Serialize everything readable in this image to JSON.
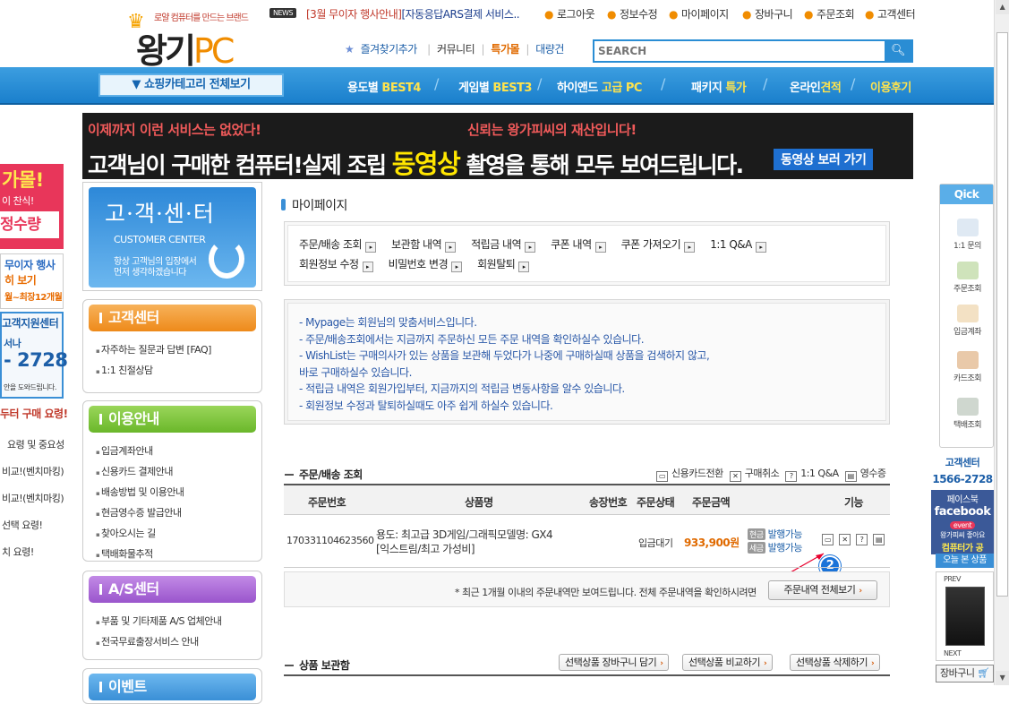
{
  "header": {
    "logo_tagline": "로얄 컴퓨터를 만드는 브랜드",
    "logo_main": "왕기",
    "logo_pc": "PC",
    "news_badge": "NEWS",
    "news_text_red": "[3월 무이자 행사안내]",
    "news_text_blue": "[자동응답ARS결제 서비스..",
    "top_links": [
      "로그아웃",
      "정보수정",
      "마이페이지",
      "장바구니",
      "주문조회",
      "고객센터"
    ],
    "bookmark": "즐겨찾기추가",
    "community": "커뮤니티",
    "special": "특가몰",
    "bulk": "대량건",
    "search_placeholder": "SEARCH"
  },
  "nav": {
    "category_button": "▼  쇼핑카테고리 전체보기",
    "items": [
      {
        "label": "용도별 ",
        "accent": "BEST4"
      },
      {
        "label": "게임별 ",
        "accent": "BEST3"
      },
      {
        "label": "하이앤드 ",
        "accent": "고급 PC"
      },
      {
        "label": "패키지 ",
        "accent": "특가"
      },
      {
        "label": "온라인",
        "accent": "견적"
      },
      {
        "label": "",
        "accent": "이용후기"
      }
    ]
  },
  "banner": {
    "line1_left": "이제까지 이런 서비스는 없었다!",
    "line1_right": "신뢰는 왕가피씨의 재산입니다!",
    "line2_a": "고객님이 구매한 컴퓨터!실제 조립 ",
    "line2_highlight": "동영상",
    "line2_b": " 촬영을 통해 모두 보여드립니다.",
    "cta": "동영상 보러 가기"
  },
  "left_ads": {
    "a1": "가몰!",
    "a2": "이 찬식!",
    "a3": "정수량",
    "b1": "무이자 행사",
    "b2": "히 보기",
    "b3": "월~최장12개월",
    "c1": "고객지원센터",
    "c2": "서나",
    "c3": "- 2728",
    "c4": "안을 도와드립니다.",
    "d1": "두터 구매 요령!",
    "d2": "요령 및 중요성",
    "d3": "비교!(벤치마킹)",
    "d4": "비교!(벤치마킹)",
    "d5": "선택 요령!",
    "d6": "치 요령!"
  },
  "customer_center_box": {
    "title": "고·객·센·터",
    "subtitle": "CUSTOMER CENTER",
    "desc1": "항상 고객님의 입장에서",
    "desc2": "먼저 생각하겠습니다"
  },
  "side_menus": [
    {
      "title": "고객센터",
      "color": "#f29a2e",
      "items": [
        "자주하는 질문과 답변 [FAQ]",
        "1:1 친절상담"
      ]
    },
    {
      "title": "이용안내",
      "color": "#7cc33a",
      "items": [
        "입금계좌안내",
        "신용카드 결제안내",
        "배송방법 및 이용안내",
        "현금영수증 발급안내",
        "찾아오시는 길",
        "택배화물추적"
      ]
    },
    {
      "title": "A/S센터",
      "color": "#a45fd0",
      "items": [
        "부품 및 기타제품 A/S 업체안내",
        "전국무료출장서비스 안내"
      ]
    },
    {
      "title": "이벤트",
      "color": "#3a8fd6",
      "items": []
    }
  ],
  "mypage": {
    "title": "마이페이지",
    "menu_row1": [
      "주문/배송 조회",
      "보관함 내역",
      "적립금 내역",
      "쿠폰 내역",
      "쿠폰 가져오기",
      "1:1 Q&A"
    ],
    "menu_row2": [
      "회원정보 수정",
      "비밀번호 변경",
      "회원탈퇴"
    ],
    "info_lines": [
      "- Mypage는 회원님의 맞춤서비스입니다.",
      "- 주문/배송조회에서는 지금까지 주문하신 모든 주문 내역을 확인하실수 있습니다.",
      "- WishList는 구매의사가 있는 상품을 보관해 두었다가 나중에 구매하실때 상품을 검색하지 않고,",
      "   바로 구매하실수 있습니다.",
      "- 적립금 내역은 회원가입부터, 지금까지의 적립금 변동사항을 알수 있습니다.",
      "- 회원정보 수정과 탈퇴하실때도 아주 쉽게 하실수 있습니다."
    ]
  },
  "orders": {
    "section_title": "주문/배송 조회",
    "legend": [
      "신용카드전환",
      "구매취소",
      "1:1 Q&A",
      "영수증"
    ],
    "headers": [
      "주문번호",
      "상품명",
      "송장번호",
      "주문상태",
      "주문금액",
      "기능"
    ],
    "rows": [
      {
        "order_no": "170331104623560",
        "product_line1": "용도: 최고급 3D게임/그래픽모델명: GX4",
        "product_line2": "[익스트림/최고 가성비]",
        "status": "입금대기",
        "amount": "933,900원",
        "pay1_label": "현금",
        "pay1_value": "발행가능",
        "pay2_label": "세금",
        "pay2_value": "발행가능"
      }
    ],
    "notice": "* 최근 1개월 이내의 주문내역만 보여드립니다. 전체 주문내역을 확인하시려면",
    "all_button": "주문내역 전체보기",
    "annotation_number": "2"
  },
  "wishlist": {
    "section_title": "상품 보관함",
    "buttons": [
      "선택상품 장바구니 담기",
      "선택상품 비교하기",
      "선택상품 삭제하기"
    ]
  },
  "quick": {
    "title": "Qick",
    "items": [
      "1:1 문의",
      "주문조회",
      "입금계좌",
      "카드조회",
      "택배조회"
    ],
    "cs_label": "고객센터",
    "cs_phone": "1566-2728",
    "fb_line1": "페이스북",
    "fb_line2": "facebook",
    "fb_line3": "event",
    "fb_line4": "왕가피씨 좋아요",
    "fb_line5": "컴퓨터가 공",
    "today_label": "오늘 본 상품",
    "prev": "PREV",
    "next": "NEXT",
    "cart": "장바구니"
  }
}
